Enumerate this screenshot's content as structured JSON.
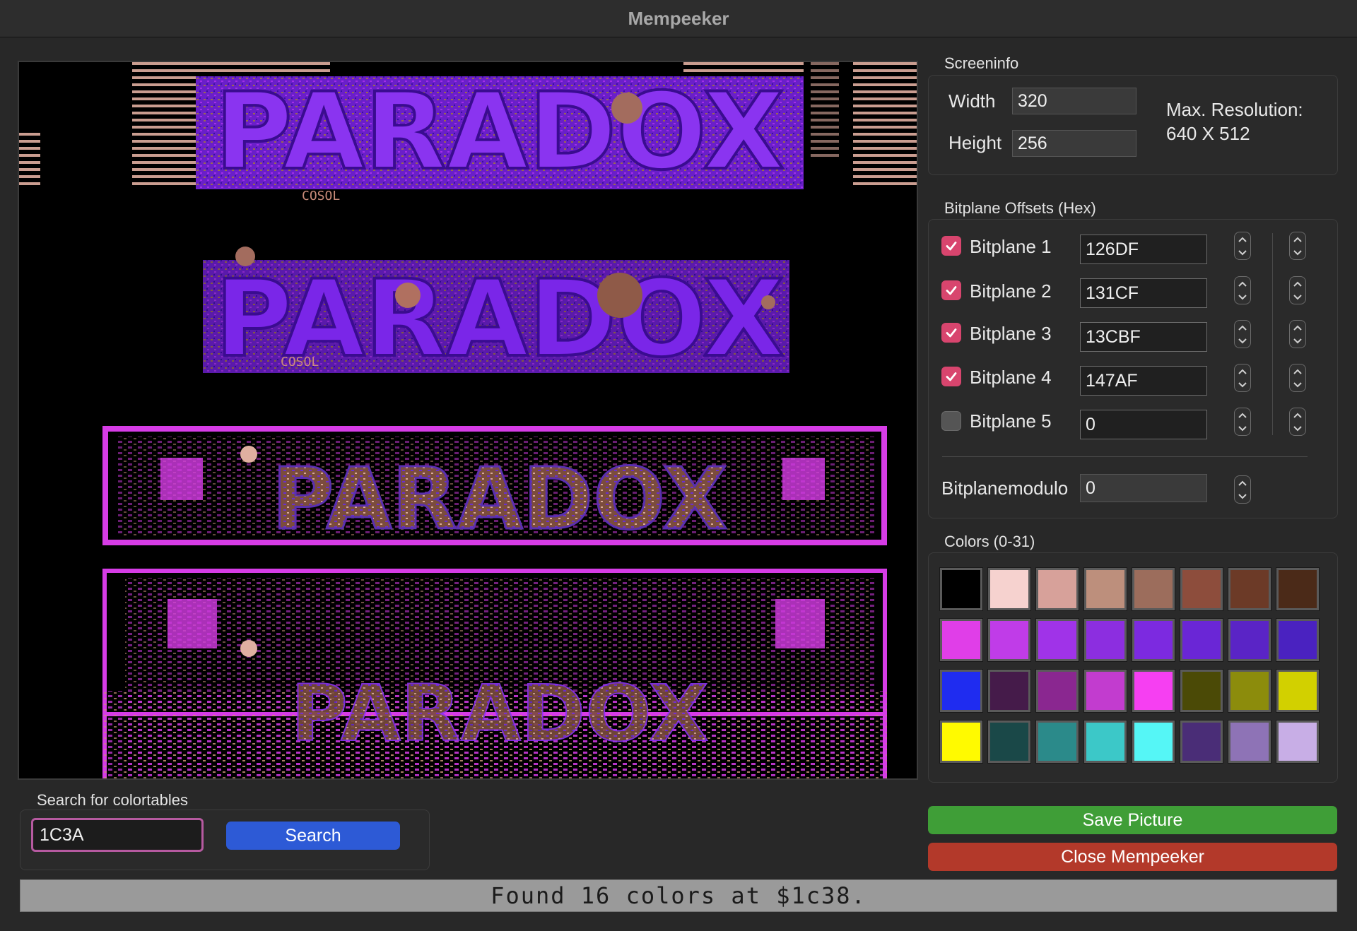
{
  "window": {
    "title": "Mempeeker"
  },
  "screeninfo": {
    "group_label": "Screeninfo",
    "width_label": "Width",
    "width_value": "320",
    "height_label": "Height",
    "height_value": "256",
    "max_resolution_line1": "Max. Resolution:",
    "max_resolution_line2": "640 X 512"
  },
  "bitplanes": {
    "group_label": "Bitplane Offsets (Hex)",
    "items": [
      {
        "label": "Bitplane 1",
        "value": "126DF",
        "checked": true
      },
      {
        "label": "Bitplane 2",
        "value": "131CF",
        "checked": true
      },
      {
        "label": "Bitplane 3",
        "value": "13CBF",
        "checked": true
      },
      {
        "label": "Bitplane 4",
        "value": "147AF",
        "checked": true
      },
      {
        "label": "Bitplane 5",
        "value": "0",
        "checked": false
      }
    ],
    "modulo_label": "Bitplanemodulo",
    "modulo_value": "0"
  },
  "colors": {
    "group_label": "Colors (0-31)",
    "palette": [
      "#000000",
      "#f6d2cf",
      "#d7a19a",
      "#bd8f7c",
      "#9c6d5c",
      "#8d4d3c",
      "#6c3a27",
      "#4b2a18",
      "#e03ee8",
      "#c03ce8",
      "#a033e8",
      "#8c2ee0",
      "#7c2ae0",
      "#6a26d6",
      "#5a24c6",
      "#4a22c0",
      "#1f2cf0",
      "#451b4a",
      "#8a2790",
      "#c23ccf",
      "#f63ff2",
      "#4b4a06",
      "#8c8c0c",
      "#d2d000",
      "#fffa00",
      "#1a4848",
      "#2b8a8a",
      "#3cc8c8",
      "#55f6f6",
      "#4a2d77",
      "#8e73b6",
      "#c8aee6"
    ]
  },
  "search": {
    "group_label": "Search for colortables",
    "input_value": "1C3A",
    "button_label": "Search"
  },
  "actions": {
    "save_label": "Save Picture",
    "close_label": "Close Mempeeker"
  },
  "status": {
    "text": "Found 16 colors at $1c38."
  },
  "preview": {
    "logo_text": "PARADOX",
    "tiny_text": "COSOL"
  }
}
